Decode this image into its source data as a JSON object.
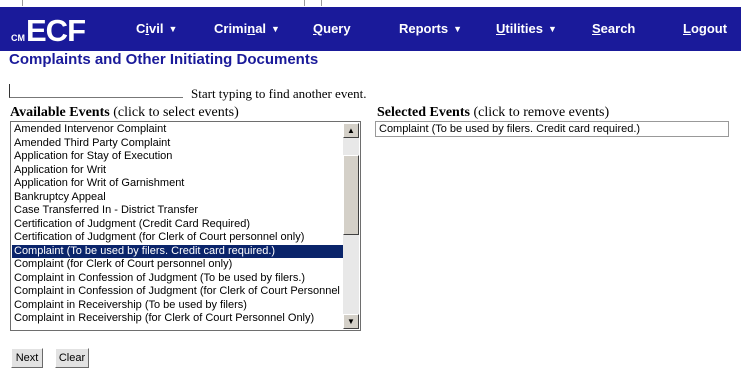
{
  "header": {
    "logo_mark": "CM",
    "logo_text": "ECF",
    "nav": [
      {
        "label": "Civil",
        "accel": "i",
        "dropdown": true
      },
      {
        "label": "Criminal",
        "accel": "n",
        "dropdown": true
      },
      {
        "label": "Query",
        "accel": "Q",
        "dropdown": false
      },
      {
        "label": "Reports",
        "accel": "",
        "dropdown": true
      },
      {
        "label": "Utilities",
        "accel": "U",
        "dropdown": true
      },
      {
        "label": "Search",
        "accel": "S",
        "dropdown": false
      },
      {
        "label": "Logout",
        "accel": "L",
        "dropdown": false
      }
    ]
  },
  "page": {
    "title": "Complaints and Other Initiating Documents",
    "finder_value": "",
    "finder_hint": "Start typing to find another event."
  },
  "available": {
    "label_bold": "Available Events",
    "label_rest": " (click to select events)",
    "items": [
      "Amended Intervenor Complaint",
      "Amended Third Party Complaint",
      "Application for Stay of Execution",
      "Application for Writ",
      "Application for Writ of Garnishment",
      "Bankruptcy Appeal",
      "Case Transferred In - District Transfer",
      "Certification of Judgment (Credit Card Required)",
      "Certification of Judgment (for Clerk of Court personnel only)",
      "Complaint (To be used by filers. Credit card required.)",
      "Complaint (for Clerk of Court personnel only)",
      "Complaint in Confession of Judgment (To be used by filers.)",
      "Complaint in Confession of Judgment (for Clerk of Court Personnel On",
      "Complaint in Receivership (To be used by filers)",
      "Complaint in Receivership (for Clerk of Court Personnel Only)"
    ],
    "selected_index": 9
  },
  "selected": {
    "label_bold": "Selected Events",
    "label_rest": " (click to remove events)",
    "items": [
      "Complaint (To be used by filers. Credit card required.)"
    ]
  },
  "buttons": {
    "next": "Next",
    "clear": "Clear"
  },
  "colors": {
    "nav_bg": "#1a1a9a",
    "title": "#1a1a9a",
    "selection_bg": "#0a246a"
  }
}
